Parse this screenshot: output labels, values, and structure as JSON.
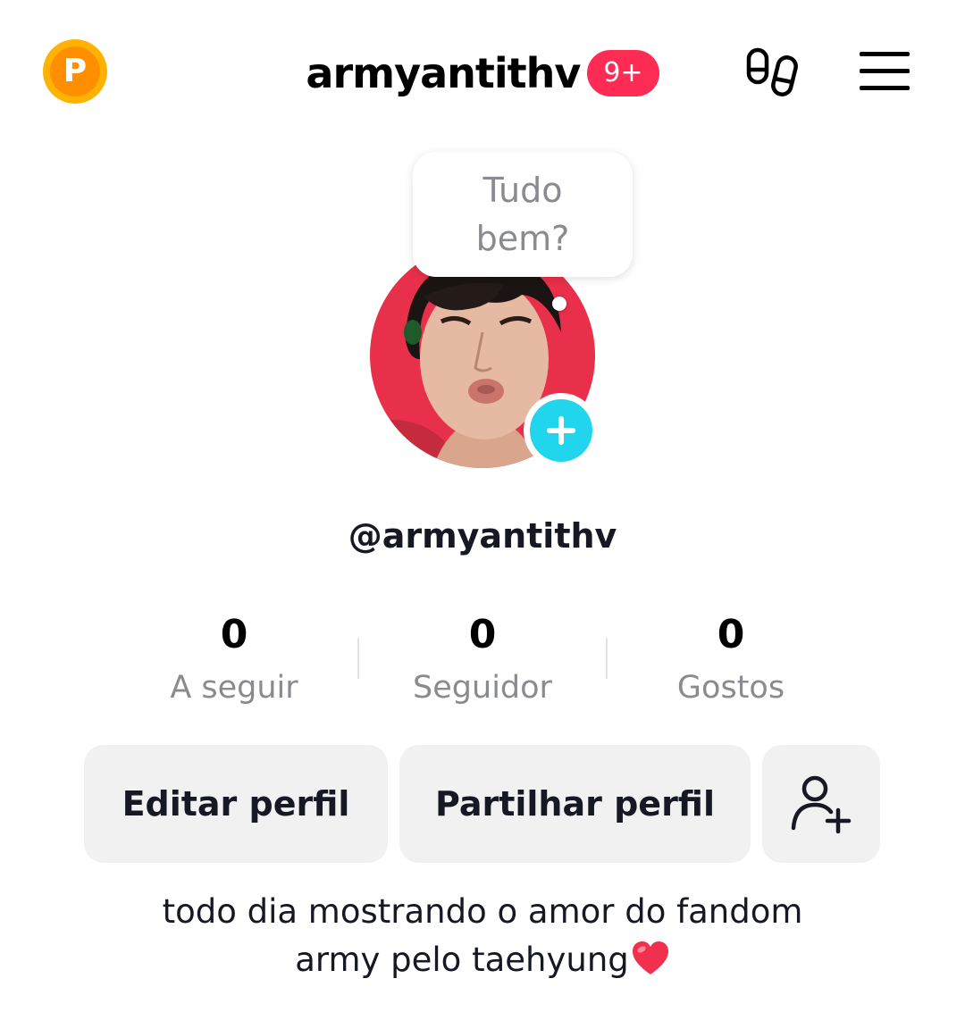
{
  "header": {
    "coin_letter": "P",
    "username": "armyantithv",
    "notification_badge": "9+",
    "icons": {
      "coin": "points-coin-icon",
      "visitors": "footprints-icon",
      "menu": "hamburger-menu-icon"
    }
  },
  "profile": {
    "status_bubble": "Tudo bem?",
    "handle": "@armyantithv",
    "avatar": "profile-photo",
    "add_story_icon": "plus-icon"
  },
  "stats": [
    {
      "value": "0",
      "label": "A seguir"
    },
    {
      "value": "0",
      "label": "Seguidor"
    },
    {
      "value": "0",
      "label": "Gostos"
    }
  ],
  "actions": {
    "edit_profile": "Editar perfil",
    "share_profile": "Partilhar perfil",
    "add_friends_icon": "add-user-icon"
  },
  "bio": {
    "line1": "todo dia mostrando o amor do fandom",
    "line2": "army pelo taehyung",
    "emoji": "red-heart-icon"
  },
  "colors": {
    "badge": "#fe2c55",
    "add_story": "#20d5ec",
    "coin": "#ff8f00",
    "button_bg": "#f1f1f2",
    "secondary_text": "#8a8b91",
    "avatar_bg": "#e8304a"
  }
}
